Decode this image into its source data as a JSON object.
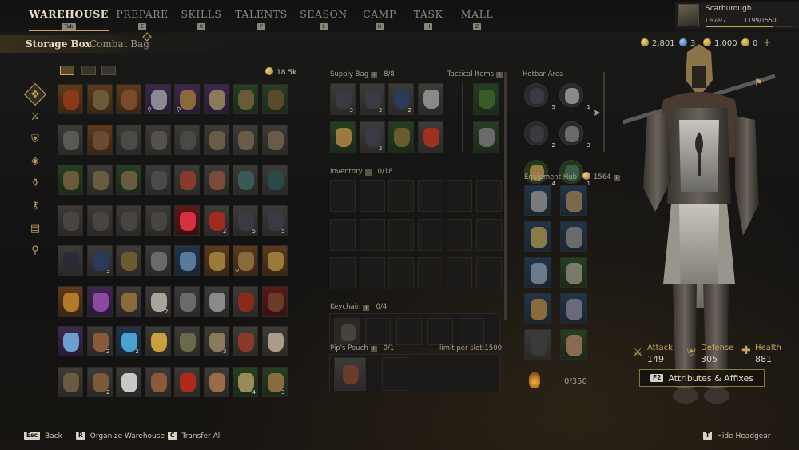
{
  "nav": {
    "tabs": [
      {
        "label": "WAREHOUSE",
        "key": "Tab"
      },
      {
        "label": "PREPARE",
        "key": "E"
      },
      {
        "label": "SKILLS",
        "key": "K"
      },
      {
        "label": "TALENTS",
        "key": "P"
      },
      {
        "label": "SEASON",
        "key": "L"
      },
      {
        "label": "CAMP",
        "key": "U"
      },
      {
        "label": "TASK",
        "key": "H"
      },
      {
        "label": "MALL",
        "key": "Z"
      }
    ],
    "active_tab": "WAREHOUSE"
  },
  "player": {
    "name": "Scarburough",
    "level": "Level7",
    "xp": "1199/1550",
    "xp_fraction": 0.7735
  },
  "subtabs": {
    "storage_box": "Storage Box",
    "combat_bag": "Combat Bag"
  },
  "currency": {
    "gold": "2,801",
    "souls": "3",
    "tokens": "1,000",
    "premium": "0",
    "plus": "+"
  },
  "storage": {
    "total": "18.5k",
    "rows": [
      [
        {
          "r": "legend",
          "c": "#8a3a1a"
        },
        {
          "r": "legend",
          "c": "#6b5a3a"
        },
        {
          "r": "legend",
          "c": "#7a4a2a"
        },
        {
          "r": "epic",
          "c": "#8a8a90",
          "lock": "⚲"
        },
        {
          "r": "epic",
          "c": "#8a6a3a",
          "lock": "⚲"
        },
        {
          "r": "epic",
          "c": "#8a7a5a"
        },
        {
          "r": "uncommon",
          "c": "#6a5a3a"
        },
        {
          "r": "uncommon",
          "c": "#5a4a2a"
        }
      ],
      [
        {
          "r": "common",
          "c": "#5a5a55"
        },
        {
          "r": "legend",
          "c": "#6a4a30"
        },
        {
          "r": "common",
          "c": "#4a4a48"
        },
        {
          "r": "common",
          "c": "#55524c"
        },
        {
          "r": "common",
          "c": "#4a4844"
        },
        {
          "r": "common",
          "c": "#6a5a48"
        },
        {
          "r": "common",
          "c": "#6a5a48"
        },
        {
          "r": "common",
          "c": "#6a5a48"
        }
      ],
      [
        {
          "r": "uncommon",
          "c": "#6a5a3a"
        },
        {
          "r": "common",
          "c": "#6a5a40"
        },
        {
          "r": "uncommon",
          "c": "#6a5a40"
        },
        {
          "r": "common",
          "c": "#4a4a4a"
        },
        {
          "r": "common",
          "c": "#8a3a2a"
        },
        {
          "r": "common",
          "c": "#7a4a3a"
        },
        {
          "r": "common",
          "c": "#3a5a5a"
        },
        {
          "r": "common",
          "c": "#2a4a4a"
        }
      ],
      [
        {
          "r": "common",
          "c": "#4a4440"
        },
        {
          "r": "common",
          "c": "#4a4440"
        },
        {
          "r": "common",
          "c": "#4a4440"
        },
        {
          "r": "common",
          "c": "#4a4440"
        },
        {
          "r": "red",
          "c": "#d83040"
        },
        {
          "r": "common",
          "c": "#a02a20",
          "count": "2"
        },
        {
          "r": "common",
          "c": "#3a3a44",
          "count": "5"
        },
        {
          "r": "common",
          "c": "#3a3a44",
          "count": "5"
        }
      ],
      [
        {
          "r": "common",
          "c": "#2a2a38"
        },
        {
          "r": "common",
          "c": "#2a3a5a",
          "count": "3"
        },
        {
          "r": "common",
          "c": "#6a5a30"
        },
        {
          "r": "common",
          "c": "#6a6a6a"
        },
        {
          "r": "rare",
          "c": "#5a7a9a"
        },
        {
          "r": "legend",
          "c": "#9a7a3a"
        },
        {
          "r": "legend",
          "c": "#8a6a3a",
          "lock": "⚲"
        },
        {
          "r": "legend",
          "c": "#9a7a3a"
        }
      ],
      [
        {
          "r": "legend",
          "c": "#b07a2a"
        },
        {
          "r": "epic",
          "c": "#8a4aa0"
        },
        {
          "r": "common",
          "c": "#8a6a3a"
        },
        {
          "r": "common",
          "c": "#aaa49a",
          "count": "2"
        },
        {
          "r": "common",
          "c": "#6a6a6a"
        },
        {
          "r": "common",
          "c": "#8a8a8a"
        },
        {
          "r": "common",
          "c": "#8a2a1a"
        },
        {
          "r": "red",
          "c": "#6a3a2a"
        }
      ],
      [
        {
          "r": "epic",
          "c": "#6aa0d0"
        },
        {
          "r": "common",
          "c": "#8a5a3a",
          "count": "2"
        },
        {
          "r": "rare",
          "c": "#4aa0d0",
          "count": "2"
        },
        {
          "r": "common",
          "c": "#c8a040"
        },
        {
          "r": "common",
          "c": "#6a6a4a"
        },
        {
          "r": "common",
          "c": "#8a7a5a",
          "count": "3"
        },
        {
          "r": "common",
          "c": "#8a3a2a"
        },
        {
          "r": "common",
          "c": "#aa9a8a"
        }
      ],
      [
        {
          "r": "common",
          "c": "#6a5a40"
        },
        {
          "r": "common",
          "c": "#7a5a3a",
          "count": "2"
        },
        {
          "r": "common",
          "c": "#c8c8c8"
        },
        {
          "r": "common",
          "c": "#8a5a3a"
        },
        {
          "r": "common",
          "c": "#b02a1a"
        },
        {
          "r": "common",
          "c": "#9a6a4a"
        },
        {
          "r": "uncommon",
          "c": "#9a8a5a",
          "count": "4"
        },
        {
          "r": "uncommon",
          "c": "#8a6a40",
          "count": "3"
        }
      ]
    ]
  },
  "supply_bag": {
    "label": "Supply Bag",
    "count": "8/8",
    "items": [
      {
        "r": "common",
        "c": "#3a3a44",
        "count": "3"
      },
      {
        "r": "common",
        "c": "#3a3a44",
        "count": "2"
      },
      {
        "r": "common",
        "c": "#2a3a5a",
        "count": "2"
      },
      {
        "r": "common",
        "c": "#8a8a8a"
      },
      {
        "r": "uncommon",
        "c": "#9a7a40"
      },
      {
        "r": "common",
        "c": "#3a3a44",
        "count": "2"
      },
      {
        "r": "uncommon",
        "c": "#6a5a30"
      },
      {
        "r": "common",
        "c": "#a03020"
      }
    ]
  },
  "tactical": {
    "label": "Tactical Items",
    "items": [
      {
        "r": "uncommon",
        "c": "#3a5a2a"
      },
      {
        "r": "uncommon",
        "c": "#6a6a6a"
      }
    ]
  },
  "inventory": {
    "label": "Inventory",
    "count": "0/18"
  },
  "keychain": {
    "label": "Keychain",
    "count": "0/4"
  },
  "pips_pouch": {
    "label": "Pip's Pouch",
    "count": "0/1",
    "limit": "limit per slot:1500"
  },
  "hotbar": {
    "label": "Hotbar Area",
    "items": [
      {
        "c": "#3a3a44",
        "count": "5",
        "bg": "#2a2a2a"
      },
      {
        "c": "#8a8a8a",
        "count": "1",
        "bg": "#2a2a2a"
      },
      {
        "c": "#3a3a44",
        "count": "2",
        "bg": "#2a2a2a"
      },
      {
        "c": "#6a6a6a",
        "count": "3",
        "bg": "#2a2a2a"
      },
      {
        "c": "#9a7a40",
        "count": "4",
        "bg": "#1f3a1a"
      },
      {
        "c": "#3a5a4a",
        "count": "1",
        "bg": "#1f3a1a"
      }
    ]
  },
  "equipment": {
    "label": "Equipment Hub:",
    "value": "1564",
    "slots": [
      {
        "r": "rare",
        "c": "#7a7a7a"
      },
      {
        "r": "rare",
        "c": "#7a6a4a"
      },
      {
        "r": "rare",
        "c": "#8a7a4a"
      },
      {
        "r": "rare",
        "c": "#6a6a6a"
      },
      {
        "r": "rare",
        "c": "#6a7a8a"
      },
      {
        "r": "uncommon",
        "c": "#7a7a6a"
      },
      {
        "r": "rare",
        "c": "#8a6a3a"
      },
      {
        "r": "rare",
        "c": "#6a6a7a"
      },
      {
        "r": "common",
        "c": "#3a3a3a"
      },
      {
        "r": "uncommon",
        "c": "#8a6a50"
      }
    ]
  },
  "lantern": {
    "value": "0/350"
  },
  "stats": {
    "attack_label": "Attack",
    "attack": "149",
    "defense_label": "Defense",
    "defense": "305",
    "health_label": "Health",
    "health": "881"
  },
  "attributes_button": {
    "key": "F2",
    "label": "Attributes & Affixes"
  },
  "footer": {
    "back_key": "Esc",
    "back": "Back",
    "organize_key": "R",
    "organize": "Organize Warehouse",
    "transfer_key": "C",
    "transfer": "Transfer All",
    "headgear_key": "T",
    "headgear": "Hide Headgear"
  },
  "colors": {
    "accent": "#c8a55a",
    "background": "#141414"
  }
}
